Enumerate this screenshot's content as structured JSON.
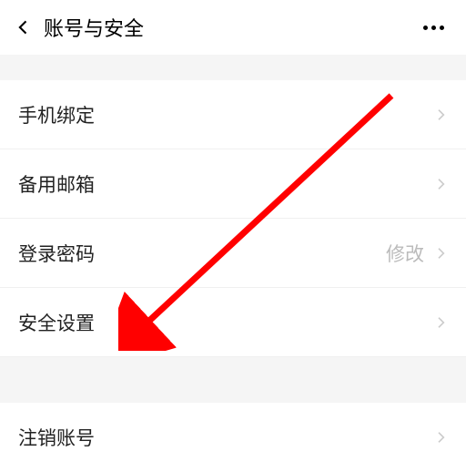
{
  "header": {
    "title": "账号与安全"
  },
  "items": {
    "phone_bind": {
      "label": "手机绑定"
    },
    "backup_email": {
      "label": "备用邮箱"
    },
    "login_password": {
      "label": "登录密码",
      "value": "修改"
    },
    "security_settings": {
      "label": "安全设置"
    },
    "delete_account": {
      "label": "注销账号"
    }
  }
}
